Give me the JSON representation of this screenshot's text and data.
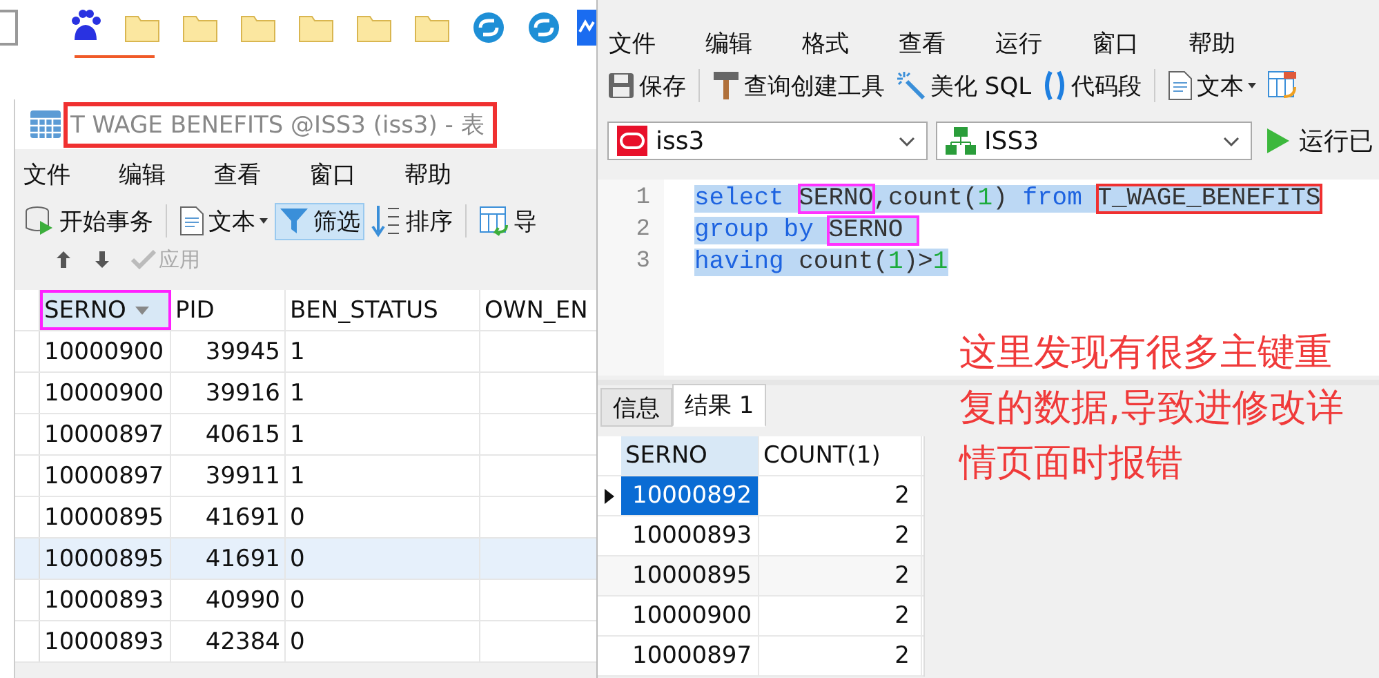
{
  "bookmarks_bar": {
    "items": [
      {
        "kind": "blank"
      },
      {
        "kind": "paw"
      },
      {
        "kind": "folder"
      },
      {
        "kind": "folder"
      },
      {
        "kind": "folder"
      },
      {
        "kind": "folder"
      },
      {
        "kind": "folder"
      },
      {
        "kind": "folder"
      },
      {
        "kind": "swirl"
      },
      {
        "kind": "swirl"
      },
      {
        "kind": "app"
      }
    ]
  },
  "table_window": {
    "title": "T WAGE BENEFITS @ISS3 (iss3) - 表",
    "title_boxed": true,
    "menu": [
      "文件",
      "编辑",
      "查看",
      "窗口",
      "帮助"
    ],
    "toolbar": [
      {
        "kind": "transaction",
        "label": "开始事务",
        "selected": false
      },
      {
        "kind": "text",
        "label": "文本",
        "selected": false
      },
      {
        "kind": "filter",
        "label": "筛选",
        "selected": true
      },
      {
        "kind": "sort",
        "label": "排序",
        "selected": false
      },
      {
        "kind": "export",
        "label": "导",
        "selected": false
      }
    ],
    "record_bar": [
      {
        "kind": "up",
        "disabled": false
      },
      {
        "kind": "down",
        "disabled": false
      },
      {
        "kind": "apply",
        "label": "应用",
        "disabled": true
      }
    ],
    "columns": [
      {
        "label": "SERNO",
        "sorted": true,
        "boxed": true,
        "kind": "text"
      },
      {
        "label": "PID",
        "sorted": false,
        "boxed": false,
        "kind": "number"
      },
      {
        "label": "BEN_STATUS",
        "sorted": false,
        "boxed": false,
        "kind": "text"
      },
      {
        "label": "OWN_EN",
        "sorted": false,
        "boxed": false,
        "kind": "text"
      }
    ],
    "rows": [
      {
        "cells": [
          "10000900",
          "39945",
          "1"
        ],
        "selected": false
      },
      {
        "cells": [
          "10000900",
          "39916",
          "1"
        ],
        "selected": false
      },
      {
        "cells": [
          "10000897",
          "40615",
          "1"
        ],
        "selected": false
      },
      {
        "cells": [
          "10000897",
          "39911",
          "1"
        ],
        "selected": false
      },
      {
        "cells": [
          "10000895",
          "41691",
          "0"
        ],
        "selected": false
      },
      {
        "cells": [
          "10000895",
          "41691",
          "0"
        ],
        "selected": true
      },
      {
        "cells": [
          "10000893",
          "40990",
          "0"
        ],
        "selected": false
      },
      {
        "cells": [
          "10000893",
          "42384",
          "0"
        ],
        "selected": false
      }
    ]
  },
  "query_window": {
    "menu": [
      "文件",
      "编辑",
      "格式",
      "查看",
      "运行",
      "窗口",
      "帮助"
    ],
    "toolbar": [
      {
        "kind": "save",
        "label": "保存"
      },
      {
        "kind": "builder",
        "label": "查询创建工具"
      },
      {
        "kind": "beautify",
        "label": "美化 SQL"
      },
      {
        "kind": "snippet",
        "label": "代码段"
      },
      {
        "kind": "text",
        "label": "文本"
      },
      {
        "kind": "export"
      }
    ],
    "connection": {
      "value": "iss3"
    },
    "schema": {
      "value": "ISS3"
    },
    "run_button": {
      "label": "运行已"
    },
    "editor": {
      "lines": [
        {
          "number": "1",
          "selected": true,
          "tokens": [
            {
              "text": "select ",
              "kind": "keyword"
            },
            {
              "text": "SERNO",
              "kind": "ident",
              "color": "#ff33ff"
            },
            {
              "text": ",count(",
              "kind": "ident"
            },
            {
              "text": "1",
              "kind": "number"
            },
            {
              "text": ") ",
              "kind": "ident"
            },
            {
              "text": "from ",
              "kind": "keyword"
            },
            {
              "text": "T_WAGE_BENEFITS",
              "kind": "ident",
              "color": "#f03030"
            }
          ]
        },
        {
          "number": "2",
          "selected": true,
          "tokens": [
            {
              "text": "group by ",
              "kind": "keyword"
            },
            {
              "text": "SERNO ",
              "kind": "ident",
              "color": "#ff33ff"
            }
          ]
        },
        {
          "number": "3",
          "selected": true,
          "tokens": [
            {
              "text": "having ",
              "kind": "keyword"
            },
            {
              "text": "count(",
              "kind": "ident"
            },
            {
              "text": "1",
              "kind": "number"
            },
            {
              "text": ")>",
              "kind": "ident"
            },
            {
              "text": "1",
              "kind": "number"
            }
          ]
        }
      ]
    },
    "tabs": [
      {
        "label": "信息",
        "selected": false
      },
      {
        "label": "结果 1",
        "selected": true
      }
    ],
    "result": {
      "columns": [
        {
          "label": "SERNO",
          "kind": "text"
        },
        {
          "label": "COUNT(1)",
          "kind": "number"
        }
      ],
      "rows": [
        {
          "cells": [
            "10000892",
            "2"
          ],
          "selected": true
        },
        {
          "cells": [
            "10000893",
            "2"
          ],
          "selected": false
        },
        {
          "cells": [
            "10000895",
            "2"
          ],
          "selected": false
        },
        {
          "cells": [
            "10000900",
            "2"
          ],
          "selected": false
        },
        {
          "cells": [
            "10000897",
            "2"
          ],
          "selected": false
        }
      ]
    },
    "note": "这里发现有很多主键重复的数据,导致进修改详情页面时报错"
  }
}
